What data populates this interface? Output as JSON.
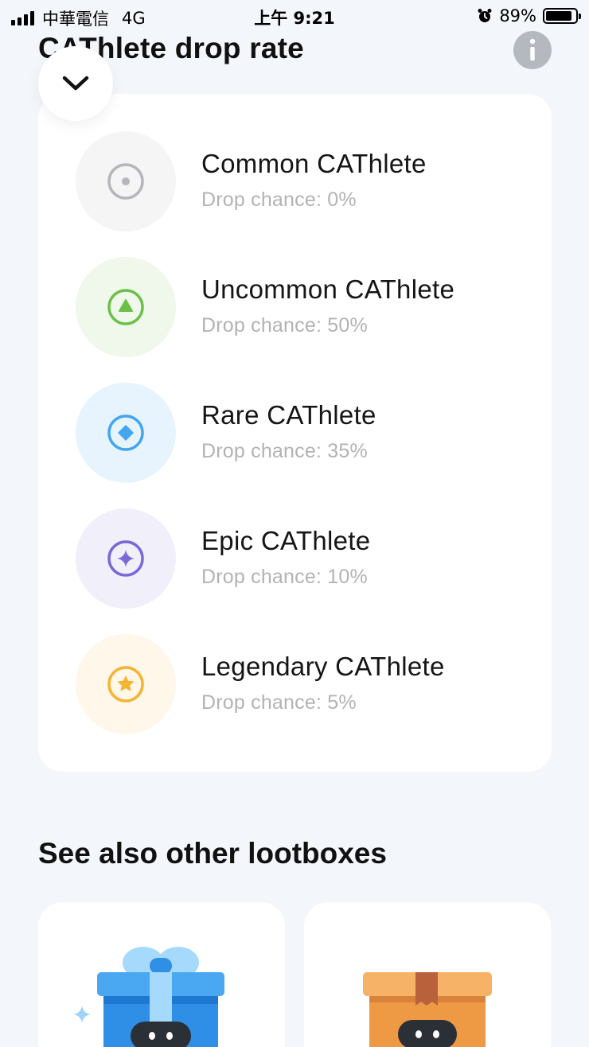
{
  "status_bar": {
    "carrier": "中華電信",
    "network": "4G",
    "time": "上午 9:21",
    "battery": "89%",
    "battery_level": 0.89
  },
  "header": {
    "title": "CAThlete drop rate",
    "info_icon": "info-icon",
    "collapse_icon": "chevron-down-icon"
  },
  "drop_rates": [
    {
      "name": "Common CAThlete",
      "chance": "Drop chance: 0%",
      "icon": "circle-dot-icon",
      "color": "#b4b6ba",
      "bg": "#f5f5f6"
    },
    {
      "name": "Uncommon CAThlete",
      "chance": "Drop chance: 50%",
      "icon": "triangle-icon",
      "color": "#6cc04a",
      "bg": "#eff8ea"
    },
    {
      "name": "Rare CAThlete",
      "chance": "Drop chance: 35%",
      "icon": "diamond-icon",
      "color": "#43a6ee",
      "bg": "#e8f4fd"
    },
    {
      "name": "Epic CAThlete",
      "chance": "Drop chance: 10%",
      "icon": "sparkle-icon",
      "color": "#7b68d8",
      "bg": "#f1eff9"
    },
    {
      "name": "Legendary CAThlete",
      "chance": "Drop chance: 5%",
      "icon": "star-icon",
      "color": "#f5b431",
      "bg": "#fef7ea"
    }
  ],
  "section": {
    "title": "See also other lootboxes"
  },
  "lootboxes": [
    {
      "icon": "blue-gift-box-icon",
      "color": "#2f8fe6"
    },
    {
      "icon": "orange-crate-box-icon",
      "color": "#ee9a45"
    }
  ]
}
